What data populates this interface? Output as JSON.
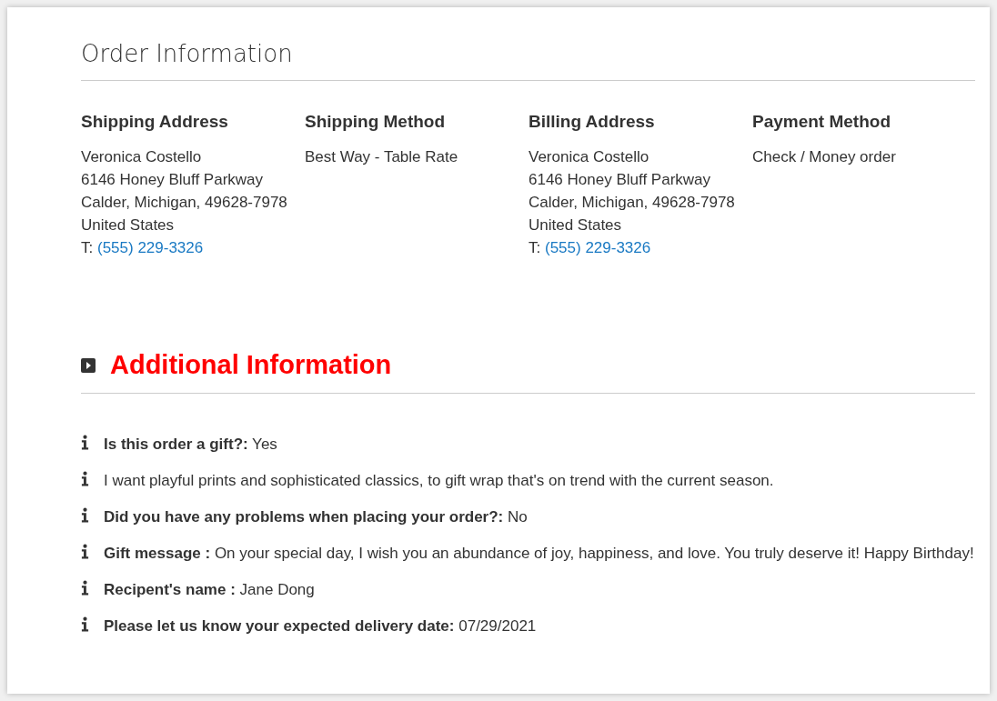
{
  "title": "Order Information",
  "columns": [
    {
      "heading": "Shipping Address",
      "lines": [
        "Veronica Costello",
        "6146 Honey Bluff Parkway",
        "Calder, Michigan, 49628-7978",
        "United States"
      ],
      "phone_label": "T:",
      "phone": "(555) 229-3326"
    },
    {
      "heading": "Shipping Method",
      "lines": [
        "Best Way - Table Rate"
      ]
    },
    {
      "heading": "Billing Address",
      "lines": [
        "Veronica Costello",
        "6146 Honey Bluff Parkway",
        "Calder, Michigan, 49628-7978",
        "United States"
      ],
      "phone_label": "T:",
      "phone": "(555) 229-3326"
    },
    {
      "heading": "Payment Method",
      "lines": [
        "Check / Money order"
      ]
    }
  ],
  "additional": {
    "title": "Additional Information",
    "items": [
      {
        "label": "Is this order a gift?:",
        "value": "Yes"
      },
      {
        "value": "I want playful prints and sophisticated classics, to gift wrap that's on trend with the current season."
      },
      {
        "label": "Did you have any problems when placing your order?:",
        "value": "No"
      },
      {
        "label": "Gift message :",
        "value": "On your special day, I wish you an abundance of joy, happiness, and love. You truly deserve it! Happy Birthday!"
      },
      {
        "label": "Recipent's name :",
        "value": "Jane Dong"
      },
      {
        "label": "Please let us know your expected delivery date:",
        "value": "07/29/2021"
      }
    ]
  }
}
